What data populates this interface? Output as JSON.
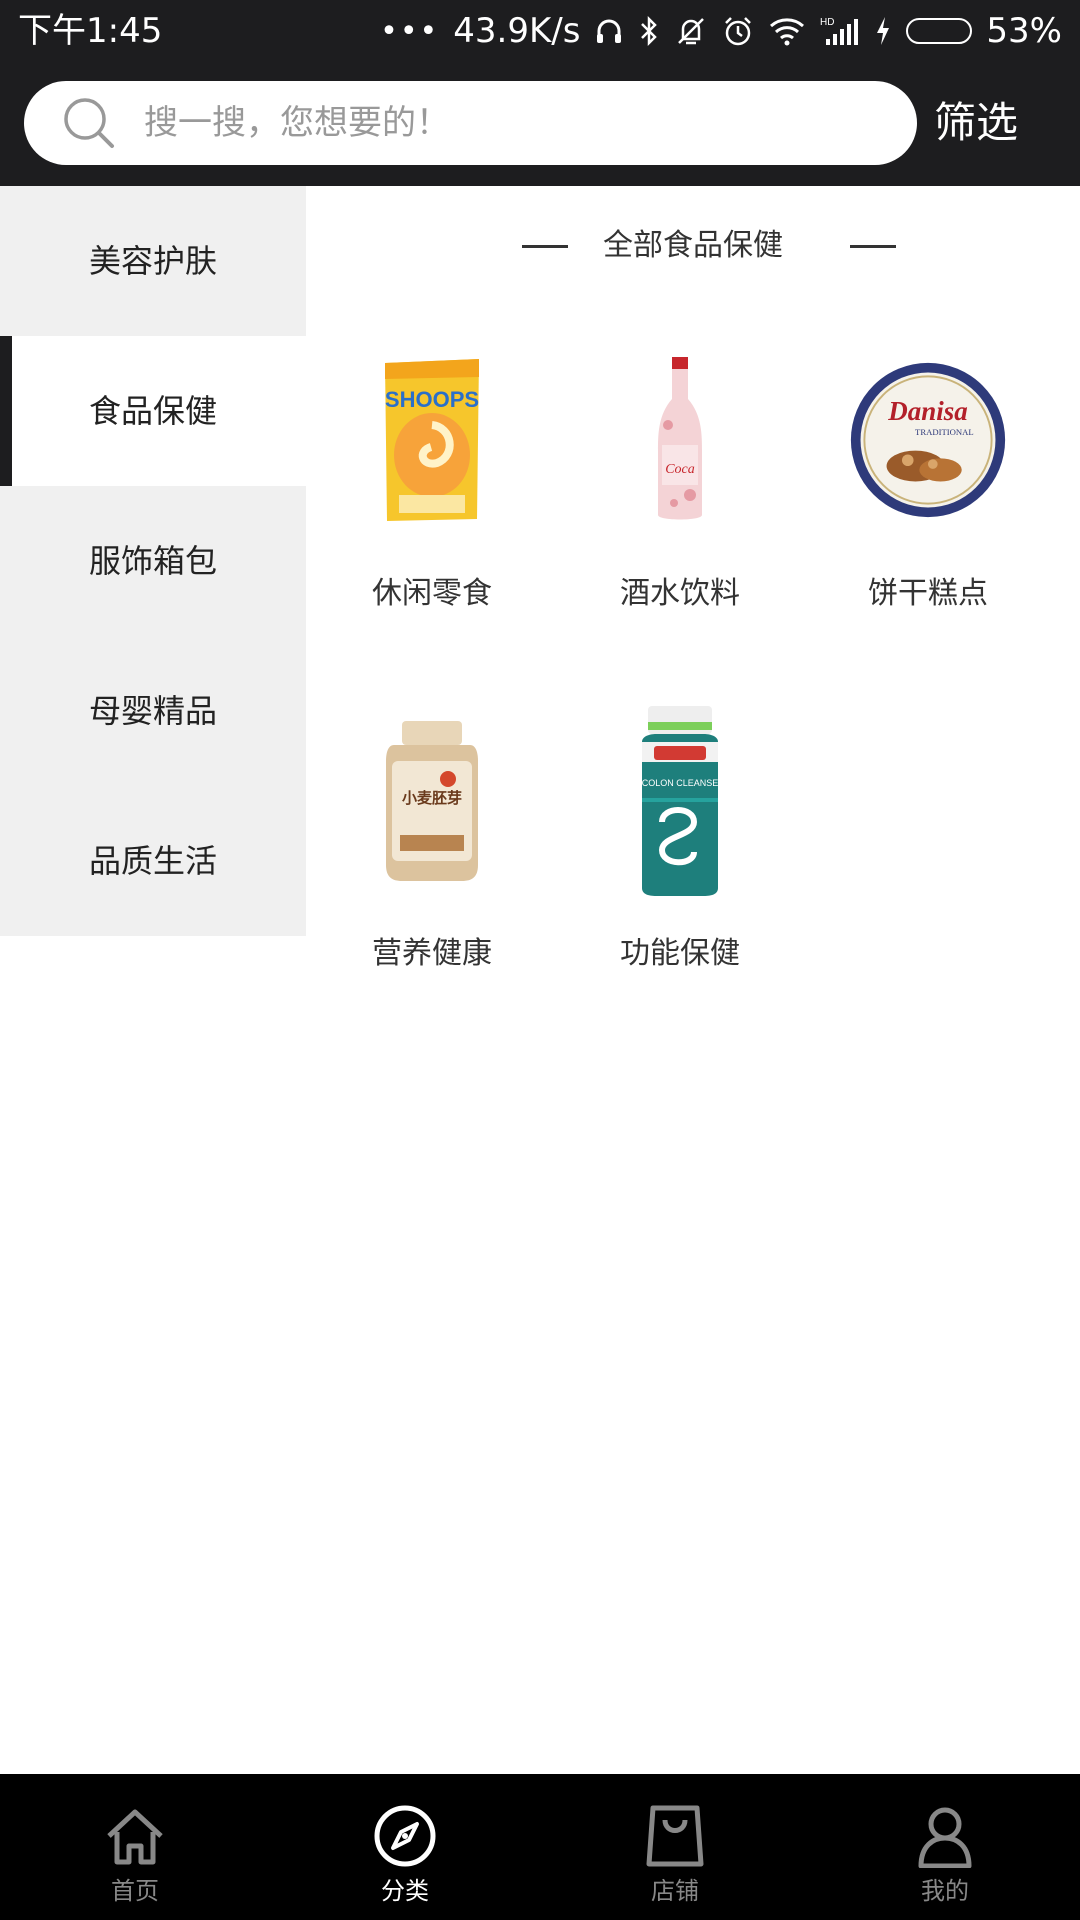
{
  "status_bar": {
    "time": "下午1:45",
    "dots": "•••",
    "speed": "43.9K/s",
    "battery": "53%",
    "battery_level": 0.53
  },
  "search": {
    "placeholder": "搜一搜，您想要的！",
    "value": "",
    "filter_label": "筛选"
  },
  "sidebar": {
    "items": [
      {
        "label": "美容护肤"
      },
      {
        "label": "食品保健"
      },
      {
        "label": "服饰箱包"
      },
      {
        "label": "母婴精品"
      },
      {
        "label": "品质生活"
      }
    ],
    "active_index": 1
  },
  "content": {
    "section_title": "全部食品保健",
    "items": [
      {
        "label": "休闲零食",
        "icon": "snack-bag-image"
      },
      {
        "label": "酒水饮料",
        "icon": "drink-bottle-image"
      },
      {
        "label": "饼干糕点",
        "icon": "cookie-tin-image"
      },
      {
        "label": "营养健康",
        "icon": "nutrition-jar-image"
      },
      {
        "label": "功能保健",
        "icon": "supplement-bottle-image"
      }
    ]
  },
  "bottom_nav": {
    "items": [
      {
        "label": "首页",
        "icon": "home-icon"
      },
      {
        "label": "分类",
        "icon": "compass-icon"
      },
      {
        "label": "店铺",
        "icon": "shop-bag-icon"
      },
      {
        "label": "我的",
        "icon": "user-icon"
      }
    ],
    "active_index": 1
  },
  "colors": {
    "header_bg": "#1d1d1f",
    "sidebar_bg": "#f0f0f0",
    "active_indicator": "#1d1d1f",
    "nav_bg": "#000000",
    "nav_inactive": "#888888",
    "nav_active": "#ffffff"
  }
}
